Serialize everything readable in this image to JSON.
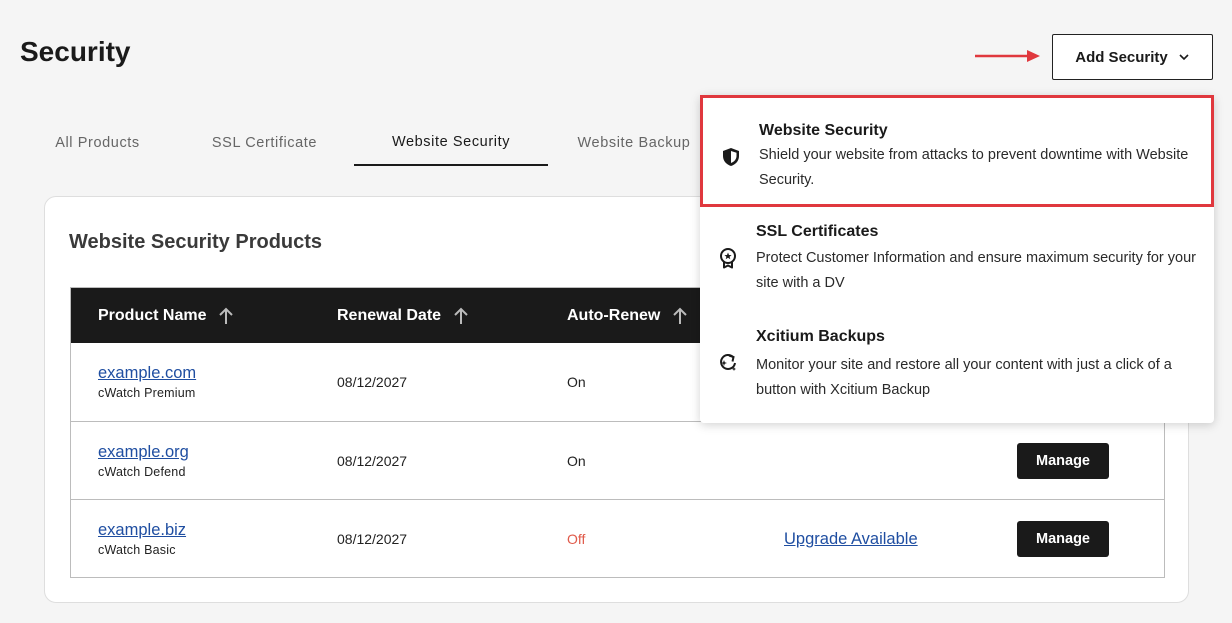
{
  "page": {
    "title": "Security"
  },
  "header": {
    "add_security_label": "Add Security",
    "annotation_arrow_color": "#e0383e"
  },
  "tabs": [
    {
      "label": "All Products",
      "active": false
    },
    {
      "label": "SSL Certificate",
      "active": false
    },
    {
      "label": "Website Security",
      "active": true
    },
    {
      "label": "Website Backup",
      "active": false
    }
  ],
  "card": {
    "title": "Website Security Products",
    "columns": [
      {
        "label": "Product Name",
        "sortable": true
      },
      {
        "label": "Renewal Date",
        "sortable": true
      },
      {
        "label": "Auto-Renew",
        "sortable": true
      }
    ],
    "rows": [
      {
        "domain": "example.com",
        "plan": "cWatch Premium",
        "renewal": "08/12/2027",
        "auto_renew": "On",
        "upgrade": "",
        "action": ""
      },
      {
        "domain": "example.org",
        "plan": "cWatch Defend",
        "renewal": "08/12/2027",
        "auto_renew": "On",
        "upgrade": "",
        "action": "Manage"
      },
      {
        "domain": "example.biz",
        "plan": "cWatch Basic",
        "renewal": "08/12/2027",
        "auto_renew": "Off",
        "upgrade": "Upgrade Available",
        "action": "Manage"
      }
    ]
  },
  "dropdown": {
    "items": [
      {
        "title": "Website Security",
        "description": "Shield your website from attacks to prevent downtime with Website Security.",
        "icon": "shield-icon",
        "highlighted": true
      },
      {
        "title": "SSL Certificates",
        "description": "Protect Customer Information and ensure maximum security for your site with a DV",
        "icon": "award-badge-icon",
        "highlighted": false
      },
      {
        "title": "Xcitium Backups",
        "description": "Monitor your site and restore all your content with just a click of a button with Xcitium Backup",
        "icon": "restore-sparkle-icon",
        "highlighted": false
      }
    ]
  },
  "colors": {
    "accent_dark": "#1a1a1a",
    "link": "#1f4ea1",
    "off_status": "#e05a4a",
    "highlight_border": "#e0383e"
  }
}
